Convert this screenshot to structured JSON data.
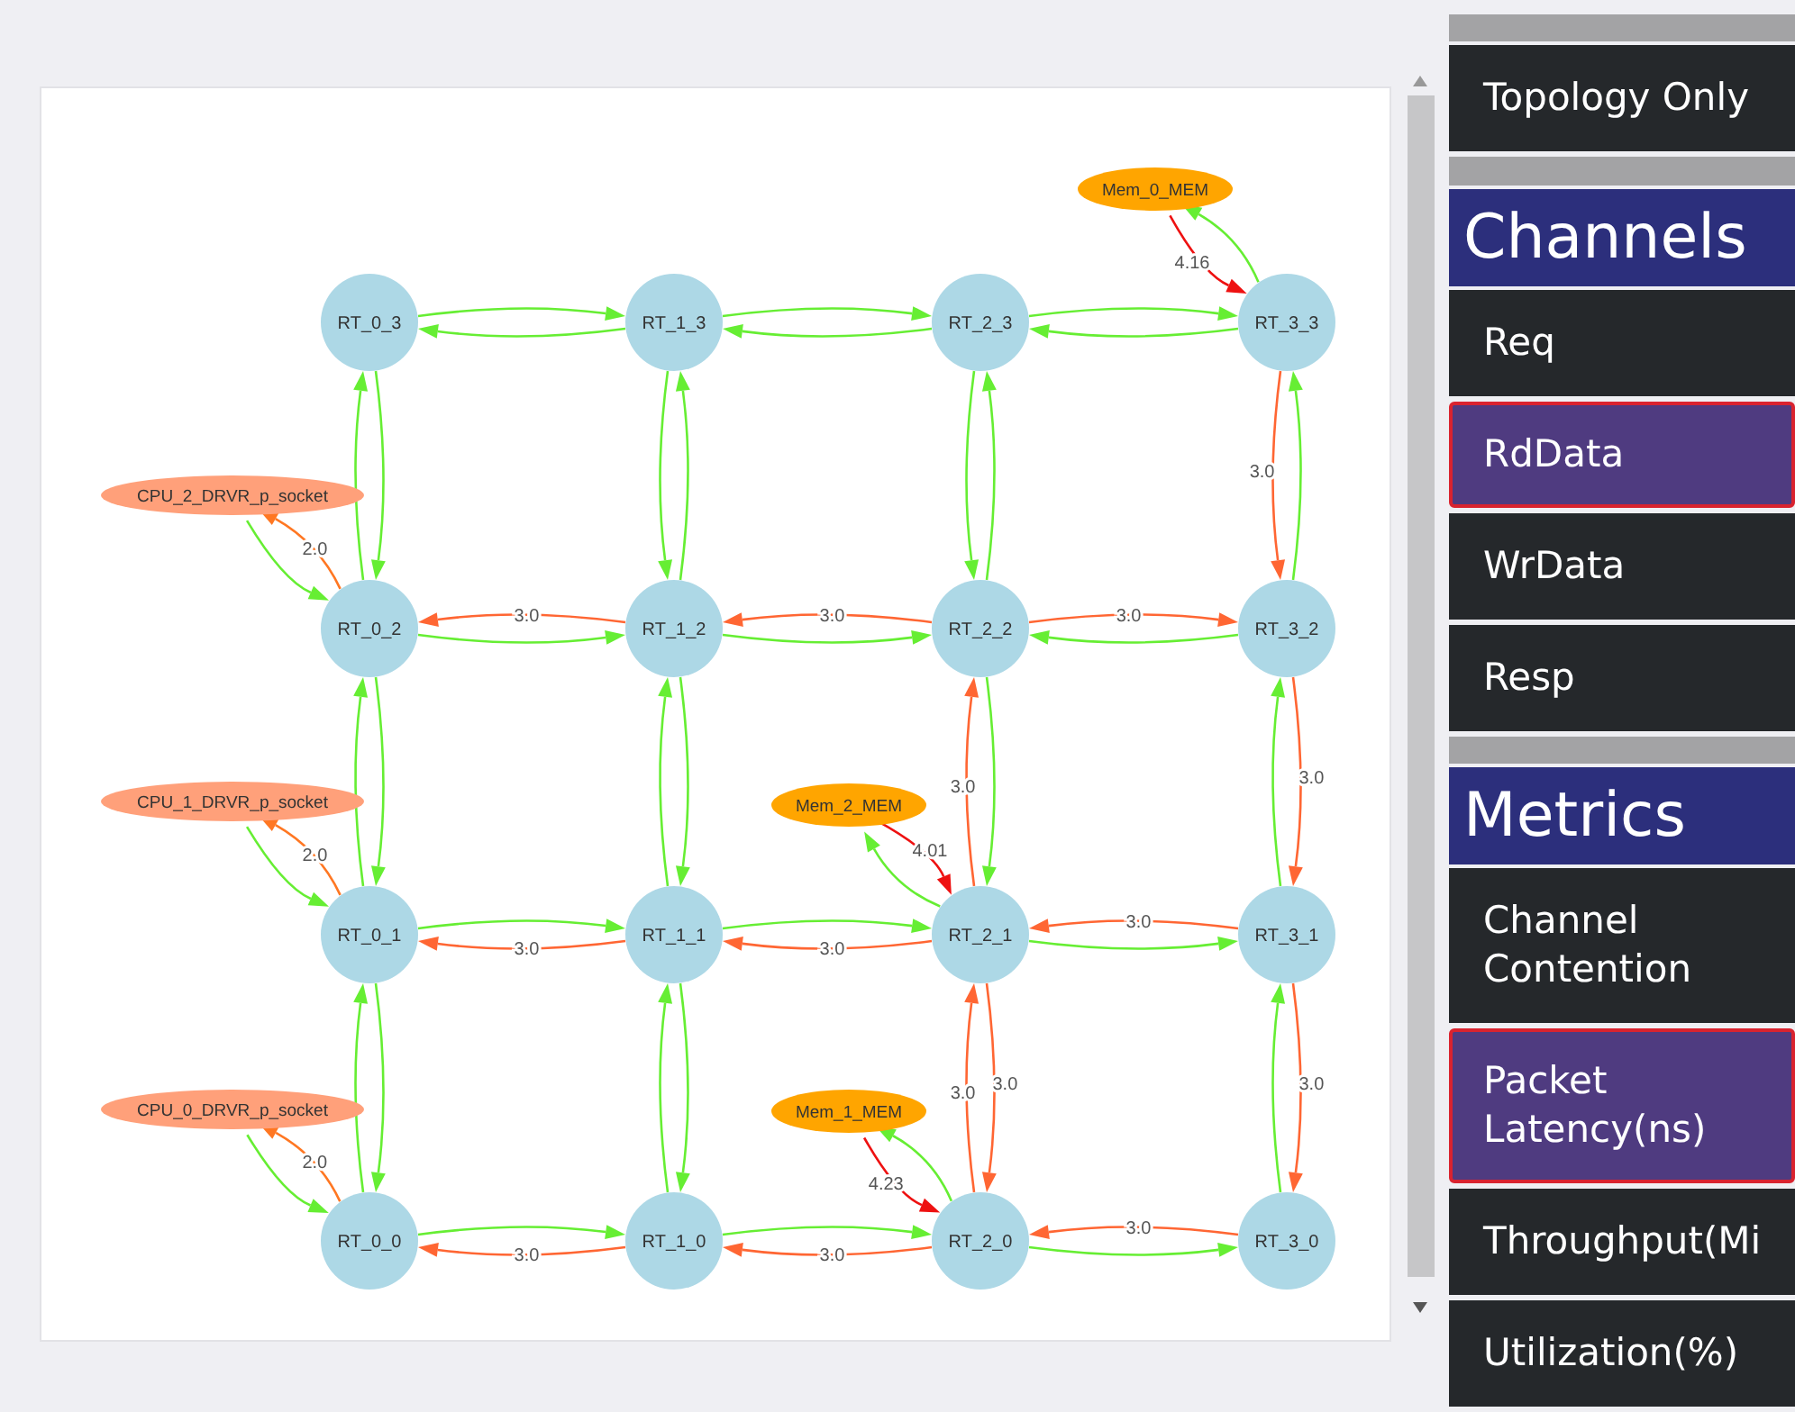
{
  "graph": {
    "nodes": [
      {
        "label": "Mem_0_MEM",
        "kind": "mem"
      },
      {
        "label": "RT_0_3",
        "kind": "router"
      },
      {
        "label": "RT_1_3",
        "kind": "router"
      },
      {
        "label": "RT_2_3",
        "kind": "router"
      },
      {
        "label": "RT_3_3",
        "kind": "router"
      },
      {
        "label": "CPU_2_DRVR_p_socket",
        "kind": "cpu"
      },
      {
        "label": "RT_0_2",
        "kind": "router"
      },
      {
        "label": "RT_1_2",
        "kind": "router"
      },
      {
        "label": "RT_2_2",
        "kind": "router"
      },
      {
        "label": "RT_3_2",
        "kind": "router"
      },
      {
        "label": "CPU_1_DRVR_p_socket",
        "kind": "cpu"
      },
      {
        "label": "Mem_2_MEM",
        "kind": "mem"
      },
      {
        "label": "RT_0_1",
        "kind": "router"
      },
      {
        "label": "RT_1_1",
        "kind": "router"
      },
      {
        "label": "RT_2_1",
        "kind": "router"
      },
      {
        "label": "RT_3_1",
        "kind": "router"
      },
      {
        "label": "CPU_0_DRVR_p_socket",
        "kind": "cpu"
      },
      {
        "label": "Mem_1_MEM",
        "kind": "mem"
      },
      {
        "label": "RT_0_0",
        "kind": "router"
      },
      {
        "label": "RT_1_0",
        "kind": "router"
      },
      {
        "label": "RT_2_0",
        "kind": "router"
      },
      {
        "label": "RT_3_0",
        "kind": "router"
      }
    ],
    "edges": [
      {
        "color": "#66ee33"
      },
      {
        "color": "#66ee33"
      },
      {
        "color": "#66ee33"
      },
      {
        "color": "#66ee33"
      },
      {
        "color": "#66ee33"
      },
      {
        "color": "#66ee33"
      },
      {
        "color": "#66ee33"
      },
      {
        "color": "#ff6633",
        "label": "3.0"
      },
      {
        "color": "#66ee33"
      },
      {
        "color": "#ff6633",
        "label": "3.0"
      },
      {
        "color": "#66ee33"
      },
      {
        "color": "#ff6633",
        "label": "3.0"
      },
      {
        "color": "#66ee33"
      },
      {
        "color": "#ff6633",
        "label": "3.0"
      },
      {
        "color": "#66ee33"
      },
      {
        "color": "#ff6633",
        "label": "3.0"
      },
      {
        "color": "#66ee33"
      },
      {
        "color": "#ff6633",
        "label": "3.0"
      },
      {
        "color": "#66ee33"
      },
      {
        "color": "#ff6633",
        "label": "3.0"
      },
      {
        "color": "#66ee33"
      },
      {
        "color": "#ff6633",
        "label": "3.0"
      },
      {
        "color": "#66ee33"
      },
      {
        "color": "#ff6633",
        "label": "3.0"
      },
      {
        "color": "#66ee33"
      },
      {
        "color": "#66ee33"
      },
      {
        "color": "#66ee33"
      },
      {
        "color": "#66ee33"
      },
      {
        "color": "#66ee33"
      },
      {
        "color": "#66ee33"
      },
      {
        "color": "#66ee33"
      },
      {
        "color": "#66ee33"
      },
      {
        "color": "#66ee33"
      },
      {
        "color": "#66ee33"
      },
      {
        "color": "#66ee33"
      },
      {
        "color": "#66ee33"
      },
      {
        "color": "#66ee33"
      },
      {
        "color": "#66ee33"
      },
      {
        "color": "#66ee33"
      },
      {
        "color": "#ff6633",
        "label": "3.0"
      },
      {
        "color": "#ff6633",
        "label": "3.0"
      },
      {
        "color": "#ff6633",
        "label": "3.0"
      },
      {
        "color": "#ff6633",
        "label": "3.0"
      },
      {
        "color": "#66ee33"
      },
      {
        "color": "#ff6633",
        "label": "3.0"
      },
      {
        "color": "#66ee33"
      },
      {
        "color": "#ff6633",
        "label": "3.0"
      },
      {
        "color": "#66ee33"
      },
      {
        "color": "#66ee33"
      },
      {
        "color": "#ff7722",
        "label": "2.0"
      },
      {
        "color": "#66ee33"
      },
      {
        "color": "#ff7722",
        "label": "2.0"
      },
      {
        "color": "#66ee33"
      },
      {
        "color": "#ff7722",
        "label": "2.0"
      },
      {
        "color": "#ee1111",
        "label": "4.16"
      },
      {
        "color": "#66ee33"
      },
      {
        "color": "#ee1111",
        "label": "4.01"
      },
      {
        "color": "#66ee33"
      },
      {
        "color": "#ee1111",
        "label": "4.23"
      },
      {
        "color": "#66ee33"
      }
    ]
  },
  "sidebar": [
    {
      "kind": "spacer"
    },
    {
      "kind": "button",
      "label": "Topology Only",
      "selected": false
    },
    {
      "kind": "spacer"
    },
    {
      "kind": "header",
      "label": "Channels"
    },
    {
      "kind": "button",
      "label": "Req",
      "selected": false
    },
    {
      "kind": "button",
      "label": "RdData",
      "selected": true
    },
    {
      "kind": "button",
      "label": "WrData",
      "selected": false
    },
    {
      "kind": "button",
      "label": "Resp",
      "selected": false
    },
    {
      "kind": "spacer"
    },
    {
      "kind": "header",
      "label": "Metrics"
    },
    {
      "kind": "button",
      "label": "Channel Contention",
      "selected": false
    },
    {
      "kind": "button",
      "label": "Packet Latency(ns)",
      "selected": true
    },
    {
      "kind": "button",
      "label": "Throughput(Mi",
      "selected": false
    },
    {
      "kind": "button",
      "label": "Utilization(%)",
      "selected": false
    }
  ]
}
